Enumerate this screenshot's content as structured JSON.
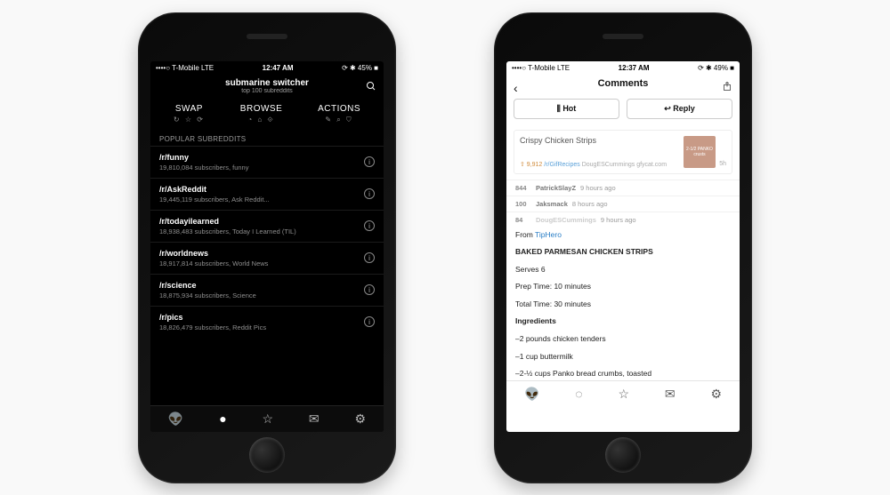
{
  "status_dark": {
    "left": "••••○ T-Mobile  LTE",
    "time": "12:47 AM",
    "right": "⟳ ✱ 45% ■"
  },
  "status_light": {
    "left": "••••○ T-Mobile  LTE",
    "time": "12:37 AM",
    "right": "⟳ ✱ 49% ■"
  },
  "dark": {
    "title": "submarine switcher",
    "subtitle": "top 100 subreddits",
    "segments": [
      {
        "label": "SWAP",
        "icons": "↻ ☆ ⟳"
      },
      {
        "label": "BROWSE",
        "icons": "◔ ⌂ ⟐"
      },
      {
        "label": "ACTIONS",
        "icons": "✎ ⌕ ⛉"
      }
    ],
    "section": "POPULAR SUBREDDITS",
    "items": [
      {
        "name": "/r/funny",
        "meta": "19,810,084 subscribers, funny"
      },
      {
        "name": "/r/AskReddit",
        "meta": "19,445,119 subscribers, Ask Reddit..."
      },
      {
        "name": "/r/todayilearned",
        "meta": "18,938,483 subscribers, Today I Learned (TIL)"
      },
      {
        "name": "/r/worldnews",
        "meta": "18,917,814 subscribers, World News"
      },
      {
        "name": "/r/science",
        "meta": "18,875,934 subscribers, Science"
      },
      {
        "name": "/r/pics",
        "meta": "18,826,479 subscribers, Reddit Pics"
      }
    ]
  },
  "light": {
    "title": "Comments",
    "buttons": {
      "hot": "Hot",
      "reply": "Reply"
    },
    "post": {
      "title": "Crispy Chicken Strips",
      "thumb": "2-1/2 PANKO crusts",
      "score": "⇧ 9,912",
      "sub": "/r/GifRecipes",
      "author": "DougESCummings",
      "domain": "gfycat.com",
      "age": "5h"
    },
    "comments": [
      {
        "score": "844",
        "user": "PatrickSlayZ",
        "age": "9 hours ago"
      },
      {
        "score": "100",
        "user": "Jaksmack",
        "age": "8 hours ago"
      },
      {
        "score": "84",
        "user": "DougESCummings",
        "age": "9 hours ago"
      }
    ],
    "body": {
      "from": "From ",
      "link": "TipHero",
      "heading": "BAKED PARMESAN CHICKEN STRIPS",
      "serves": "Serves 6",
      "prep": "Prep Time: 10 minutes",
      "total": "Total Time: 30 minutes",
      "ing_label": "Ingredients",
      "ing": [
        "–2 pounds chicken tenders",
        "–1 cup buttermilk",
        "–2-½ cups Panko bread crumbs, toasted"
      ]
    }
  }
}
